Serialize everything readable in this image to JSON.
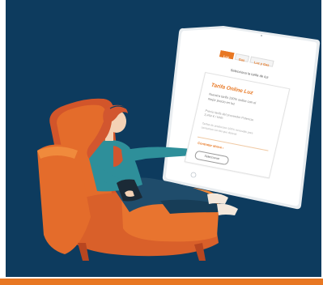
{
  "colors": {
    "background": "#0d3b5e",
    "accent": "#e87722",
    "chair": "#e46c2b",
    "woman_top": "#2e8f9a",
    "woman_pants": "#1f4c6b",
    "hair": "#d2562f"
  },
  "illustration": {
    "description_icon": "woman-on-armchair-with-tablet-icon"
  },
  "tablet": {
    "tabs": [
      "Luz",
      "Gas",
      "Luz y Gas"
    ],
    "heading": "Selecciona la tarifa de luz",
    "card": {
      "title": "Tarifa Online Luz",
      "description": "Nuestra tarifa 100% online con el mejor precio en luz",
      "price": "Precio tarifa del proveedor Potencia 3,464 € / kWh",
      "note": "Tarifas de produccion 100% renovable para consumos con los que deseas",
      "link": "Contratar ahora ›",
      "button": "Seleccionar"
    }
  }
}
